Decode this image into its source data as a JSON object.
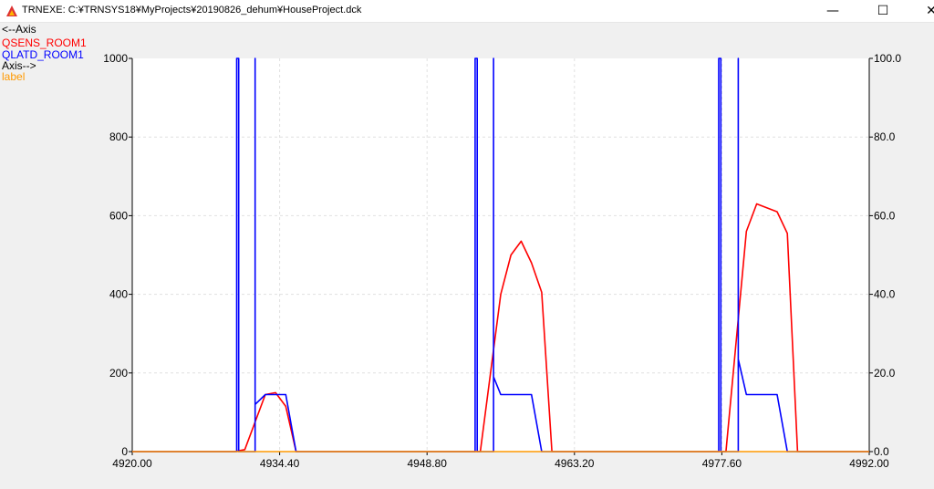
{
  "window": {
    "title": "TRNEXE: C:¥TRNSYS18¥MyProjects¥20190826_dehum¥HouseProject.dck",
    "minimize_glyph": "—",
    "maximize_glyph": "☐",
    "close_glyph": "✕"
  },
  "colors": {
    "qsens": "#ff0000",
    "qlatd": "#0000ff",
    "label": "#ff9900",
    "axis_text": "#000000",
    "plot_bg": "#ffffff",
    "grid": "#e0e0e0"
  },
  "legend": {
    "left_axis_label": "<--Axis",
    "series1": "QSENS_ROOM1",
    "series2": "QLATD_ROOM1",
    "right_axis_label": "Axis-->",
    "series3": "label"
  },
  "chart_data": {
    "type": "line",
    "xlim": [
      4920,
      4992
    ],
    "ylim_left": [
      0,
      1000
    ],
    "ylim_right": [
      0,
      100
    ],
    "x_ticks": [
      "4920.00",
      "4934.40",
      "4948.80",
      "4963.20",
      "4977.60",
      "4992.00"
    ],
    "y_left_ticks": [
      "0",
      "200",
      "400",
      "600",
      "800",
      "1000"
    ],
    "y_right_ticks": [
      "0.0",
      "20.0",
      "40.0",
      "60.0",
      "80.0",
      "100.0"
    ],
    "grid": true,
    "legend_position": "top-left",
    "series": [
      {
        "name": "QSENS_ROOM1",
        "axis": "left",
        "color": "#ff0000",
        "points": [
          [
            4920,
            0
          ],
          [
            4930,
            0
          ],
          [
            4931,
            5
          ],
          [
            4933,
            145
          ],
          [
            4934,
            150
          ],
          [
            4935,
            115
          ],
          [
            4936,
            0
          ],
          [
            4954,
            0
          ],
          [
            4956,
            400
          ],
          [
            4957,
            500
          ],
          [
            4958,
            535
          ],
          [
            4959,
            480
          ],
          [
            4960,
            405
          ],
          [
            4961,
            0
          ],
          [
            4978,
            0
          ],
          [
            4980,
            560
          ],
          [
            4981,
            630
          ],
          [
            4983,
            610
          ],
          [
            4984,
            555
          ],
          [
            4985,
            0
          ],
          [
            4992,
            0
          ]
        ]
      },
      {
        "name": "QLATD_ROOM1",
        "axis": "left",
        "color": "#0000ff",
        "points": [
          [
            4920,
            0
          ],
          [
            4930.2,
            0
          ],
          [
            4930.2,
            1000
          ],
          [
            4930.4,
            1000
          ],
          [
            4930.4,
            0
          ],
          [
            4932,
            0
          ],
          [
            4932,
            1000
          ],
          [
            4932,
            120
          ],
          [
            4933,
            145
          ],
          [
            4935,
            145
          ],
          [
            4936,
            0
          ],
          [
            4953.5,
            0
          ],
          [
            4953.5,
            1000
          ],
          [
            4953.7,
            1000
          ],
          [
            4953.7,
            0
          ],
          [
            4955.3,
            0
          ],
          [
            4955.3,
            1000
          ],
          [
            4955.3,
            190
          ],
          [
            4956,
            145
          ],
          [
            4959,
            145
          ],
          [
            4960,
            0
          ],
          [
            4977.3,
            0
          ],
          [
            4977.3,
            1000
          ],
          [
            4977.5,
            1000
          ],
          [
            4977.5,
            0
          ],
          [
            4979.2,
            0
          ],
          [
            4979.2,
            1000
          ],
          [
            4979.2,
            235
          ],
          [
            4980,
            145
          ],
          [
            4983,
            145
          ],
          [
            4984,
            0
          ],
          [
            4992,
            0
          ]
        ]
      },
      {
        "name": "label",
        "axis": "right",
        "color": "#ff9900",
        "points": [
          [
            4920,
            0
          ],
          [
            4992,
            0
          ]
        ]
      }
    ]
  }
}
